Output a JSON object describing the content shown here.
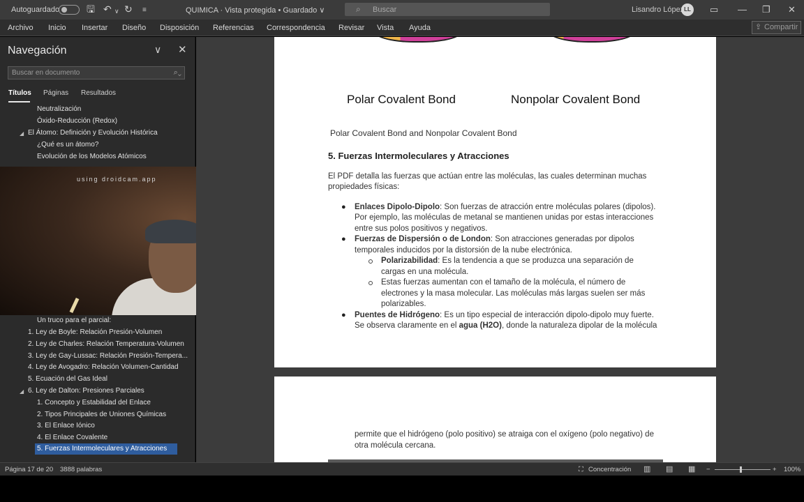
{
  "titlebar": {
    "autosave_label": "Autoguardado",
    "doc_title": "QUIMICA  ·  Vista protegida  •  Guardado ∨",
    "search_placeholder": "Buscar",
    "user_name": "Lisandro López",
    "user_initials": "LL"
  },
  "menu": {
    "items": [
      "Archivo",
      "Inicio",
      "Insertar",
      "Diseño",
      "Disposición",
      "Referencias",
      "Correspondencia",
      "Revisar",
      "Vista",
      "Ayuda"
    ],
    "share_label": "Compartir"
  },
  "navigation": {
    "title": "Navegación",
    "search_placeholder": "Buscar en documento",
    "tabs": [
      "Títulos",
      "Páginas",
      "Resultados"
    ],
    "items_top": [
      "Neutralización",
      "Óxido-Reducción (Redox)",
      "El Átomo: Definición y Evolución Histórica",
      "¿Qué es un átomo?",
      "Evolución de los Modelos Atómicos"
    ],
    "items_bottom": [
      "Un truco para el parcial:",
      "1. Ley de Boyle: Relación Presión-Volumen",
      "2. Ley de Charles: Relación Temperatura-Volumen",
      "3. Ley de Gay-Lussac: Relación Presión-Tempera...",
      "4. Ley de Avogadro: Relación Volumen-Cantidad",
      "5. Ecuación del Gas Ideal",
      "6. Ley de Dalton: Presiones Parciales",
      "1. Concepto y Estabilidad del Enlace",
      "2. Tipos Principales de Uniones Químicas",
      "3. El Enlace Iónico",
      "4. El Enlace Covalente",
      "5. Fuerzas Intermoleculares y Atracciones"
    ]
  },
  "webcam": {
    "watermark": "using droidcam.app"
  },
  "document": {
    "image_label_left": "Polar Covalent Bond",
    "image_label_right": "Nonpolar Covalent Bond",
    "caption": "Polar Covalent Bond and Nonpolar Covalent Bond",
    "heading": "5. Fuerzas Intermoleculares y Atracciones",
    "intro_1": "El PDF detalla las fuerzas que actúan entre las moléculas, las cuales determinan muchas",
    "intro_2": "propiedades físicas:",
    "b1_bold": "Enlaces Dipolo-Dipolo",
    "b1_l1": ": Son fuerzas de atracción entre moléculas polares (dipolos).",
    "b1_l2": "Por ejemplo, las moléculas de metanal se mantienen unidas por estas interacciones",
    "b1_l3": "entre sus polos positivos y negativos.",
    "b2_bold": "Fuerzas de Dispersión o de London",
    "b2_l1": ": Son atracciones generadas por dipolos",
    "b2_l2": "temporales inducidos por la distorsión de la nube electrónica.",
    "s1_bold": "Polarizabilidad",
    "s1_l1": ": Es la tendencia a que se produzca una separación de",
    "s1_l2": "cargas en una molécula.",
    "s2_l1": "Estas fuerzas aumentan con el tamaño de la molécula, el número de",
    "s2_l2": "electrones y la masa molecular. Las moléculas más largas suelen ser más",
    "s2_l3": "polarizables.",
    "b3_bold": "Puentes de Hidrógeno",
    "b3_l1": ": Es un tipo especial de interacción dipolo-dipolo muy fuerte.",
    "b3_l2a": "Se observa claramente en el ",
    "b3_l2b": "agua (H2O)",
    "b3_l2c": ", donde la naturaleza dipolar de la molécula",
    "p2_l1": "permite que el hidrógeno (polo positivo) se atraiga con el oxígeno (polo negativo) de",
    "p2_l2": "otra molécula cercana."
  },
  "status": {
    "page": "Página 17 de 20",
    "words": "3888 palabras",
    "focus": "Concentración",
    "zoom": "100%"
  },
  "colors": {
    "selection": "#2f5d9e",
    "pie_orange": "#f0b64a",
    "pie_magenta": "#d0409a"
  }
}
